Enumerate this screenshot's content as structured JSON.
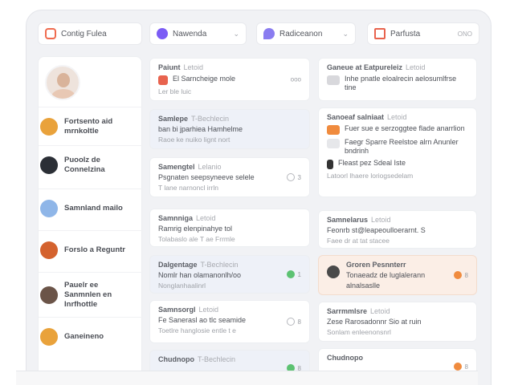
{
  "toolbar": {
    "item1": {
      "label": "Contig Fulea",
      "icon": "calendar-icon",
      "color": "#ef6b4f"
    },
    "item2": {
      "label": "Nawenda",
      "icon": "status-dot-icon",
      "color": "#7b5cf5"
    },
    "item3": {
      "label": "Radiceanon",
      "icon": "pin-icon",
      "color": "#8a7cf0"
    },
    "item4": {
      "label": "Parfusta",
      "suffix": "ONO",
      "icon": "document-icon",
      "color": "#e8634e"
    }
  },
  "sidebar": {
    "contacts": [
      {
        "name": "Fortsento aid mrnkoltle",
        "color": "#e9a23b"
      },
      {
        "name": "Puoolz de Connelzina",
        "color": "#2b2f36"
      },
      {
        "name": "Samnland mailo",
        "color": "#8fb6e8"
      },
      {
        "name": "Forslo a Reguntr",
        "color": "#d4622e"
      },
      {
        "name": "Pauelr ee Sanmnlen en Inrfhottle",
        "color": "#6b5448"
      },
      {
        "name": "Ganeineno",
        "color": "#e9a23b"
      }
    ]
  },
  "col1": [
    {
      "title": "Paiunt",
      "time": "Letoid",
      "line1": "El Sarncheige mole",
      "line2": "Ler ble luic",
      "meta": "ooo",
      "icon_color": "#e8634e"
    },
    {
      "title": "Samlepe",
      "time": "T-Bechlecin",
      "line1": "ban bi jparhiea Hamhelme",
      "line2": "Raoe ke nuiko lignt nort",
      "style": "blue"
    },
    {
      "title": "Samengtel",
      "time": "Lelanio",
      "line1": "Psgnaten seepsyneeve selele",
      "line2": "T lane narnoncl irrln",
      "meta": "3"
    },
    {
      "title": "Samnniga",
      "time": "Letoid",
      "line1": "Ramrig elenpinahye tol",
      "line2": "Tolabaslo ale T ae Frrmle"
    },
    {
      "title": "Dalgentage",
      "time": "T-Bechlecin",
      "line1": "Nomlr han olamanonlh/oo",
      "line2": "Nonglanhaalinrl",
      "meta": "1",
      "style": "blue",
      "dot_color": "#5cc272"
    },
    {
      "title": "Samnsorgl",
      "time": "Letoid",
      "line1": "Fe Sanerasl ao tlc seamide",
      "line2": "Toetlre hanglosie entle t e",
      "meta": "8"
    },
    {
      "title": "Chudnopo",
      "time": "T-Bechlecin",
      "line1": "",
      "line2": "",
      "style": "blue",
      "meta": "8",
      "dot_color": "#5cc272"
    }
  ],
  "col2": [
    {
      "title": "Ganeue at Eatpureleiz",
      "time": "Letoid",
      "rows": [
        {
          "text": "Inhe pnatle eloalrecin aelosumlfrse tine",
          "color": "#d8d8dc"
        }
      ]
    },
    {
      "title": "Sanoeaf salniaat",
      "time": "Letoid",
      "rows": [
        {
          "text": "Fuer sue e serzoggtee flade anarrlion",
          "color": "#f08b3e"
        },
        {
          "text": "Faegr Sparre Reelstoe alrn Anunler bndrinh",
          "color": "#e6e7ea"
        },
        {
          "text": "Fleast pez Sdeal Iste",
          "color": "#333333"
        }
      ],
      "footer": "Latoorl lhaere loriogsedelam"
    },
    {
      "title": "Samnelarus",
      "time": "Letoid",
      "line1": "Feonrb st@leapeoulloerarnt. S",
      "line2": "Faee dr at tat stacee"
    },
    {
      "title": "Groren Pesnnterr",
      "time": "",
      "line1": "Tonaeadz de luglalerann",
      "line2": "alnalsaslle",
      "style": "peach",
      "meta": "8",
      "dot_color": "#f08b3e"
    },
    {
      "title": "Sarrmmlsre",
      "time": "Letoid",
      "line1": "Zese Rarosadonnr Sio at ruin",
      "line2": "Sonlam enleenonsnrl"
    },
    {
      "title": "Chudnopo",
      "time": "",
      "line1": "",
      "line2": "",
      "meta": "8",
      "dot_color": "#f08b3e"
    }
  ]
}
